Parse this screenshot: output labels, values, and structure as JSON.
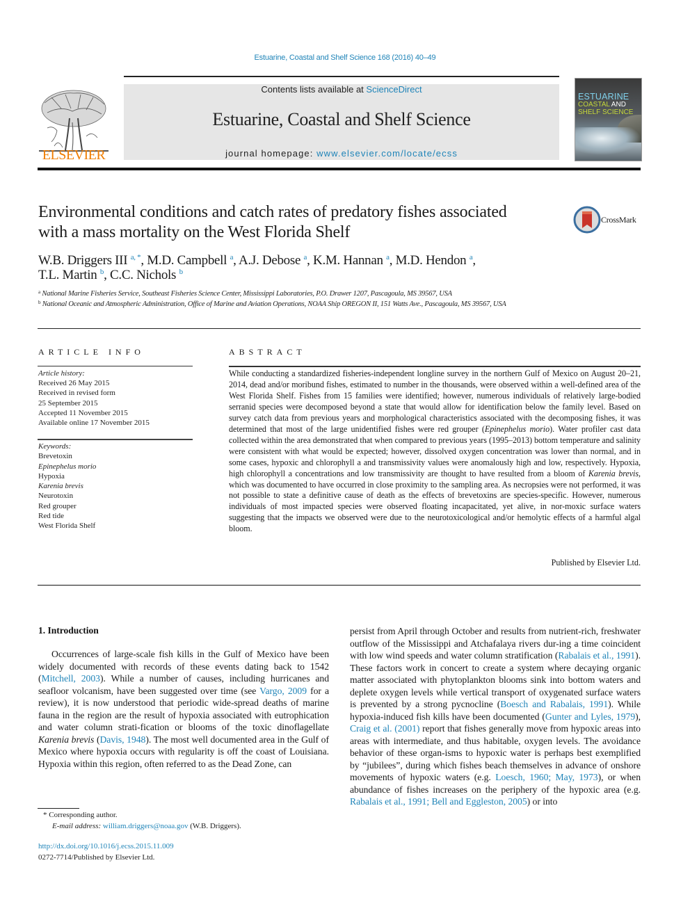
{
  "running_head": "Estuarine, Coastal and Shelf Science 168 (2016) 40–49",
  "publisher_logo": {
    "word": "ELSEVIER",
    "icon": "elsevier-tree-icon",
    "color": "#f07d00"
  },
  "banner": {
    "contents_prefix": "Contents lists available at ",
    "contents_link": "ScienceDirect",
    "journal_title": "Estuarine, Coastal and Shelf Science",
    "homepage_prefix": "journal homepage: ",
    "homepage_link": "www.elsevier.com/locate/ecss"
  },
  "cover": {
    "line1": "ESTUARINE",
    "line2a": "COASTAL",
    "line2b": " AND",
    "line3": "SHELF SCIENCE"
  },
  "crossmark": {
    "label": "CrossMark",
    "icon": "crossmark-icon"
  },
  "article": {
    "title": "Environmental conditions and catch rates of predatory fishes associated with a mass mortality on the West Florida Shelf",
    "authors": [
      {
        "name": "W.B. Driggers III",
        "sup": "a, *"
      },
      {
        "name": "M.D. Campbell",
        "sup": "a"
      },
      {
        "name": "A.J. Debose",
        "sup": "a"
      },
      {
        "name": "K.M. Hannan",
        "sup": "a"
      },
      {
        "name": "M.D. Hendon",
        "sup": "a"
      },
      {
        "name": "T.L. Martin",
        "sup": "b"
      },
      {
        "name": "C.C. Nichols",
        "sup": "b"
      }
    ],
    "affiliations": [
      {
        "key": "a",
        "text": "National Marine Fisheries Service, Southeast Fisheries Science Center, Mississippi Laboratories, P.O. Drawer 1207, Pascagoula, MS 39567, USA"
      },
      {
        "key": "b",
        "text": "National Oceanic and Atmospheric Administration, Office of Marine and Aviation Operations, NOAA Ship OREGON II, 151 Watts Ave., Pascagoula, MS 39567, USA"
      }
    ]
  },
  "article_info": {
    "heading": "ARTICLE INFO",
    "history_label": "Article history:",
    "history": [
      "Received 26 May 2015",
      "Received in revised form",
      "25 September 2015",
      "Accepted 11 November 2015",
      "Available online 17 November 2015"
    ],
    "keywords_label": "Keywords:",
    "keywords": [
      {
        "text": "Brevetoxin",
        "italic": false
      },
      {
        "text": "Epinephelus morio",
        "italic": true
      },
      {
        "text": "Hypoxia",
        "italic": false
      },
      {
        "text": "Karenia brevis",
        "italic": true
      },
      {
        "text": "Neurotoxin",
        "italic": false
      },
      {
        "text": "Red grouper",
        "italic": false
      },
      {
        "text": "Red tide",
        "italic": false
      },
      {
        "text": "West Florida Shelf",
        "italic": false
      }
    ]
  },
  "abstract": {
    "heading": "ABSTRACT",
    "p1": "While conducting a standardized fisheries-independent longline survey in the northern Gulf of Mexico on August 20–21, 2014, dead and/or moribund fishes, estimated to number in the thousands, were observed within a well-defined area of the West Florida Shelf. Fishes from 15 families were identified; however, numerous individuals of relatively large-bodied serranid species were decomposed beyond a state that would allow for identification below the family level. Based on survey catch data from previous years and morphological characteristics associated with the decomposing fishes, it was determined that most of the large unidentified fishes were red grouper (",
    "p1_italic": "Epinephelus morio",
    "p2": "). Water profiler cast data collected within the area demonstrated that when compared to previous years (1995–2013) bottom temperature and salinity were consistent with what would be expected; however, dissolved oxygen concentration was lower than normal, and in some cases, hypoxic and chlorophyll a and transmissivity values were anomalously high and low, respectively. Hypoxia, high chlorophyll a concentrations and low transmissivity are thought to have resulted from a bloom of ",
    "p2_italic": "Karenia brevis",
    "p3": ", which was documented to have occurred in close proximity to the sampling area. As necropsies were not performed, it was not possible to state a definitive cause of death as the effects of brevetoxins are species-specific. However, numerous individuals of most impacted species were observed floating incapacitated, yet alive, in nor-moxic surface waters suggesting that the impacts we observed were due to the neurotoxicological and/or hemolytic effects of a harmful algal bloom.",
    "publisher_line": "Published by Elsevier Ltd."
  },
  "introduction": {
    "heading": "1.  Introduction",
    "left": [
      {
        "t": "Occurrences of large-scale fish kills in the Gulf of Mexico have been widely documented with records of these events dating back to 1542 ("
      },
      {
        "link": "Mitchell, 2003"
      },
      {
        "t": "). While a number of causes, including hurricanes and seafloor volcanism, have been suggested over time (see "
      },
      {
        "link": "Vargo, 2009"
      },
      {
        "t": " for a review), it is now understood that periodic wide-spread deaths of marine fauna in the region are the result of hypoxia associated with eutrophication and water column strati-fication or blooms of the toxic dinoflagellate "
      },
      {
        "i": "Karenia brevis"
      },
      {
        "t": " ("
      },
      {
        "link": "Davis, 1948"
      },
      {
        "t": "). The most well documented area in the Gulf of Mexico where hypoxia occurs with regularity is off the coast of Louisiana. Hypoxia within this region, often referred to as the Dead Zone, can"
      }
    ],
    "right": [
      {
        "t": "persist from April through October and results from nutrient-rich, freshwater outflow of the Mississippi and Atchafalaya rivers dur-ing a time coincident with low wind speeds and water column stratification ("
      },
      {
        "link": "Rabalais et al., 1991"
      },
      {
        "t": "). These factors work in concert to create a system where decaying organic matter associated with phytoplankton blooms sink into bottom waters and deplete oxygen levels while vertical transport of oxygenated surface waters is prevented by a strong pycnocline ("
      },
      {
        "link": "Boesch and Rabalais, 1991"
      },
      {
        "t": "). While hypoxia-induced fish kills have been documented ("
      },
      {
        "link": "Gunter and Lyles, 1979"
      },
      {
        "t": "), "
      },
      {
        "link": "Craig et al. (2001)"
      },
      {
        "t": " report that fishes generally move from hypoxic areas into areas with intermediate, and thus habitable, oxygen levels. The avoidance behavior of these organ-isms to hypoxic water is perhaps best exemplified by “jubilees”, during which fishes beach themselves in advance of onshore movements of hypoxic waters (e.g. "
      },
      {
        "link": "Loesch, 1960; May, 1973"
      },
      {
        "t": "), or when abundance of fishes increases on the periphery of the hypoxic area (e.g. "
      },
      {
        "link": "Rabalais et al., 1991; Bell and Eggleston, 2005"
      },
      {
        "t": ") or into"
      }
    ]
  },
  "footnotes": {
    "corresponding": "* Corresponding author.",
    "email_label": "E-mail address:",
    "email": "william.driggers@noaa.gov",
    "email_suffix": " (W.B. Driggers).",
    "doi": "http://dx.doi.org/10.1016/j.ecss.2015.11.009",
    "issn": "0272-7714/Published by Elsevier Ltd."
  },
  "colors": {
    "link": "#1f84b8",
    "elsevier_orange": "#f07d00",
    "banner_gray": "#e6e6e6"
  }
}
